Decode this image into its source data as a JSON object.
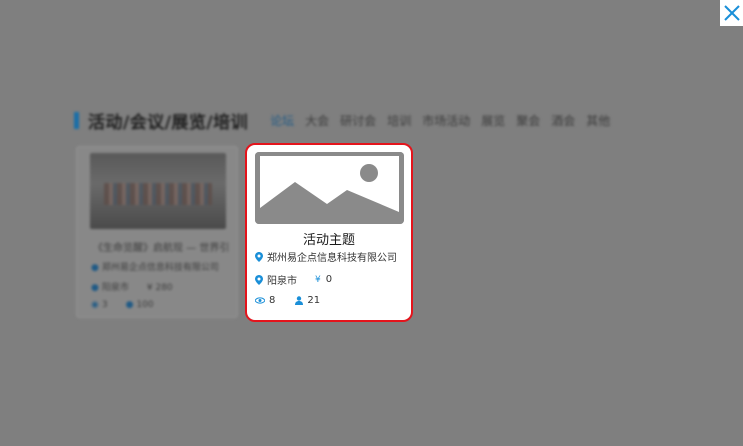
{
  "section": {
    "title": "活动/会议/展览/培训",
    "tabs": [
      "论坛",
      "大会",
      "研讨会",
      "培训",
      "市场活动",
      "展览",
      "聚会",
      "酒会",
      "其他"
    ],
    "active_tab_index": 0
  },
  "background_card": {
    "title": "《生命览醒》启航现 — 世界引",
    "company": "郑州易企点信息科技有限公司",
    "city": "阳泉市",
    "price": "¥ 280",
    "views": "3",
    "participants": "100"
  },
  "card": {
    "title": "活动主题",
    "company": "郑州易企点信息科技有限公司",
    "city": "阳泉市",
    "price_symbol": "¥",
    "price": "0",
    "views": "8",
    "participants": "21"
  },
  "colors": {
    "overlay": "#7f7f7f",
    "accent": "#1a6fa8",
    "highlight_border": "#e4141c",
    "icon_blue": "#1a8fd8"
  },
  "icons": {
    "close": "close-icon",
    "image_placeholder": "image-placeholder-icon",
    "location": "location-pin-icon",
    "views": "eye-icon",
    "participants": "person-icon"
  }
}
